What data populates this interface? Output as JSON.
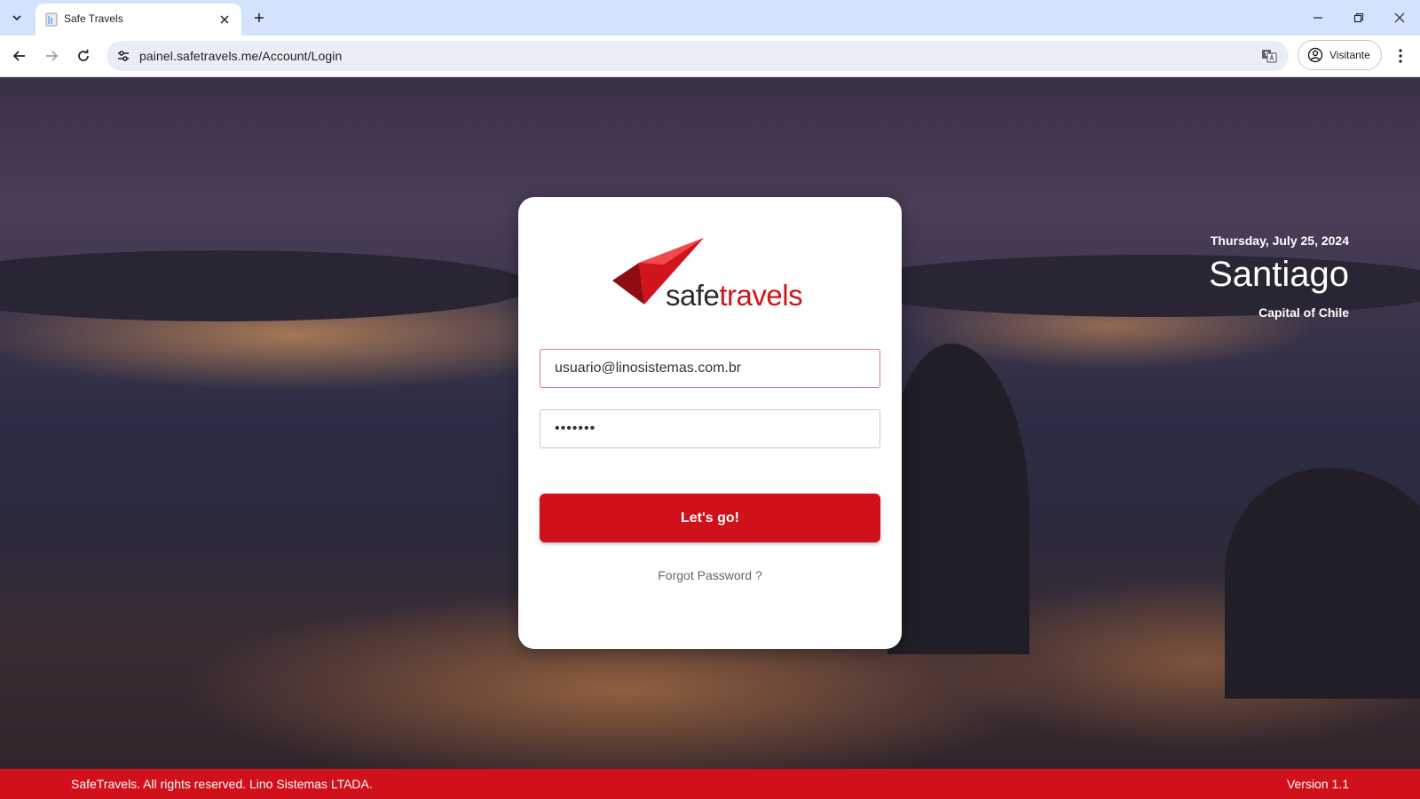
{
  "browser": {
    "tab_title": "Safe Travels",
    "url": "painel.safetravels.me/Account/Login",
    "profile_label": "Visitante"
  },
  "login": {
    "logo_safe": "safe",
    "logo_travels": "travels",
    "email_value": "usuario@linosistemas.com.br",
    "password_mask": "•••••••",
    "submit_label": "Let's go!",
    "forgot_label": "Forgot Password ?"
  },
  "location": {
    "date": "Thursday, July 25, 2024",
    "city": "Santiago",
    "subtitle": "Capital of Chile"
  },
  "footer": {
    "copyright": "SafeTravels. All rights reserved. Lino Sistemas LTADA.",
    "version": "Version 1.1"
  },
  "colors": {
    "brand_red": "#d0101a",
    "chrome_tab_strip": "#d3e3fd"
  }
}
